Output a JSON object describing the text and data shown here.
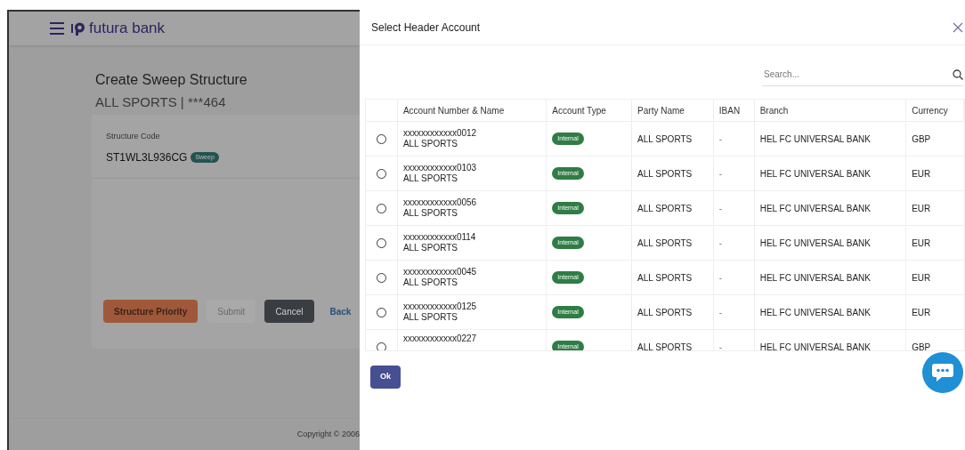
{
  "page": {
    "brand": "futura bank",
    "title": "Create Sweep Structure",
    "subtitle": "ALL SPORTS | ***464",
    "structure_code_label": "Structure Code",
    "structure_code": "ST1WL3L936CG",
    "structure_badge": "Sweep",
    "buttons": [
      {
        "label": "Structure Priority",
        "kind": "primary"
      },
      {
        "label": "Submit",
        "kind": "disabled"
      },
      {
        "label": "Cancel",
        "kind": "dark"
      },
      {
        "label": "Back",
        "kind": "link"
      }
    ],
    "footer": "Copyright © 2006"
  },
  "modal": {
    "title": "Select Header Account",
    "search": {
      "placeholder": "Search..."
    },
    "columns": [
      "Account Number & Name",
      "Account Type",
      "Party Name",
      "IBAN",
      "Branch",
      "Currency"
    ],
    "rows": [
      {
        "selected": false,
        "account": "xxxxxxxxxxxx0012",
        "name": "ALL SPORTS",
        "type": "Internal",
        "party": "ALL SPORTS",
        "iban": "-",
        "branch": "HEL FC UNIVERSAL BANK",
        "currency": "GBP"
      },
      {
        "selected": false,
        "account": "xxxxxxxxxxxx0103",
        "name": "ALL SPORTS",
        "type": "Internal",
        "party": "ALL SPORTS",
        "iban": "-",
        "branch": "HEL FC UNIVERSAL BANK",
        "currency": "EUR"
      },
      {
        "selected": false,
        "account": "xxxxxxxxxxxx0056",
        "name": "ALL SPORTS",
        "type": "Internal",
        "party": "ALL SPORTS",
        "iban": "-",
        "branch": "HEL FC UNIVERSAL BANK",
        "currency": "EUR"
      },
      {
        "selected": false,
        "account": "xxxxxxxxxxxx0114",
        "name": "ALL SPORTS",
        "type": "Internal",
        "party": "ALL SPORTS",
        "iban": "-",
        "branch": "HEL FC UNIVERSAL BANK",
        "currency": "EUR"
      },
      {
        "selected": false,
        "account": "xxxxxxxxxxxx0045",
        "name": "ALL SPORTS",
        "type": "Internal",
        "party": "ALL SPORTS",
        "iban": "-",
        "branch": "HEL FC UNIVERSAL BANK",
        "currency": "EUR"
      },
      {
        "selected": false,
        "account": "xxxxxxxxxxxx0125",
        "name": "ALL SPORTS",
        "type": "Internal",
        "party": "ALL SPORTS",
        "iban": "-",
        "branch": "HEL FC UNIVERSAL BANK",
        "currency": "EUR"
      },
      {
        "selected": false,
        "account": "xxxxxxxxxxxx0227",
        "type": "Internal",
        "party": "ALL SPORTS",
        "iban": "-",
        "branch": "HEL FC UNIVERSAL BANK",
        "currency": "GBP"
      }
    ],
    "ok": "Ok"
  }
}
